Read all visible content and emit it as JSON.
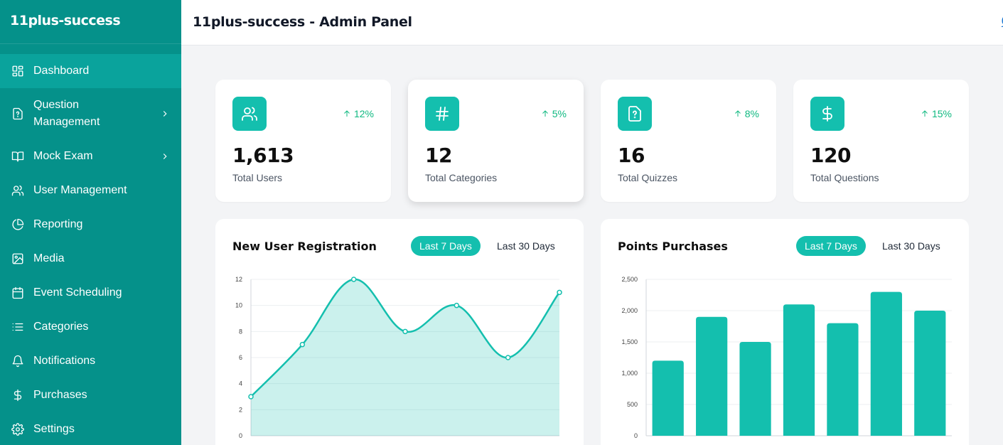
{
  "brand": "11plus-success",
  "header": {
    "title": "11plus-success - Admin Panel"
  },
  "sidebar": {
    "items": [
      {
        "label": "Dashboard",
        "icon": "dashboard-icon",
        "active": true
      },
      {
        "label": "Question Management",
        "icon": "question-file-icon",
        "submenu": true
      },
      {
        "label": "Mock Exam",
        "icon": "book-open-icon",
        "submenu": true
      },
      {
        "label": "User Management",
        "icon": "users-icon"
      },
      {
        "label": "Reporting",
        "icon": "pie-chart-icon"
      },
      {
        "label": "Media",
        "icon": "image-icon"
      },
      {
        "label": "Event Scheduling",
        "icon": "calendar-icon"
      },
      {
        "label": "Categories",
        "icon": "list-icon"
      },
      {
        "label": "Notifications",
        "icon": "bell-icon"
      },
      {
        "label": "Purchases",
        "icon": "dollar-icon"
      },
      {
        "label": "Settings",
        "icon": "gear-icon"
      }
    ]
  },
  "stats": [
    {
      "value": "1,613",
      "label": "Total Users",
      "change": "12%",
      "icon": "users-icon"
    },
    {
      "value": "12",
      "label": "Total Categories",
      "change": "5%",
      "icon": "hash-icon"
    },
    {
      "value": "16",
      "label": "Total Quizzes",
      "change": "8%",
      "icon": "question-file-icon"
    },
    {
      "value": "120",
      "label": "Total Questions",
      "change": "15%",
      "icon": "dollar-icon"
    }
  ],
  "charts": {
    "registration": {
      "title": "New User Registration",
      "tab_active": "Last 7 Days",
      "tab_other": "Last 30 Days"
    },
    "purchases": {
      "title": "Points Purchases",
      "tab_active": "Last 7 Days",
      "tab_other": "Last 30 Days"
    }
  },
  "colors": {
    "sidebar": "#05918a",
    "accent": "#14bfae",
    "positive": "#10b981"
  },
  "chart_data": [
    {
      "type": "area",
      "values": [
        3,
        7,
        12,
        8,
        10,
        6,
        11
      ],
      "ylim": [
        0,
        12
      ],
      "yticks": [
        "0",
        "2",
        "4",
        "6",
        "8",
        "10",
        "12"
      ],
      "grid": true
    },
    {
      "type": "bar",
      "values": [
        1200,
        1900,
        1500,
        2100,
        1800,
        2300,
        2000
      ],
      "ylim": [
        0,
        2500
      ],
      "yticks": [
        "0",
        "500",
        "1,000",
        "1,500",
        "2,000",
        "2,500"
      ],
      "grid": true
    }
  ]
}
